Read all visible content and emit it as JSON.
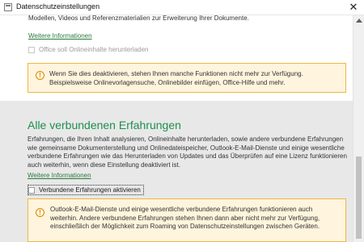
{
  "window": {
    "title": "Datenschutzeinstellungen",
    "close_glyph": "✕"
  },
  "top_section": {
    "intro_fragment": "Modellen, Videos und Referenzmaterialien zur Erweiterung Ihrer Dokumente.",
    "more_info_link": "Weitere Informationen",
    "checkbox_label": "Office soll Onlineinhalte herunterladen",
    "checkbox_checked": false,
    "notice": "Wenn Sie dies deaktivieren, stehen Ihnen manche Funktionen nicht mehr zur Verfügung. Beispielsweise Onlinevorlagensuche, Onlinebilder einfügen, Office-Hilfe und mehr."
  },
  "connected_section": {
    "heading": "Alle verbundenen Erfahrungen",
    "description": "Erfahrungen, die Ihren Inhalt analysieren, Onlineinhalte herunterladen, sowie andere verbundene Erfahrungen wie gemeinsame Dokumenterstellung und Onlinedateispeicher, Outlook-E-Mail-Dienste und einige wesentliche verbundene Erfahrungen wie das Herunterladen von Updates und das Überprüfen auf eine Lizenz funktionieren auch weiterhin, wenn diese Einstellung deaktiviert ist.",
    "more_info_link": "Weitere Informationen",
    "checkbox_label": "Verbundene Erfahrungen aktivieren",
    "checkbox_checked": false,
    "notice": "Outlook-E-Mail-Dienste und einige wesentliche verbundene Erfahrungen funktionieren auch weiterhin. Andere verbundene Erfahrungen stehen Ihnen dann aber nicht mehr zur Verfügung, einschließlich der Möglichkeit zum Roaming von Datenschutzeinstellungen zwischen Geräten."
  },
  "colors": {
    "accent_green": "#1e8f4e",
    "link_green": "#2b7a3d",
    "notice_bg": "#fff4dd",
    "notice_border": "#f0b640",
    "section_gray": "#e8e8e8"
  },
  "icons": {
    "app": "document-icon",
    "warning": "warning-icon",
    "close": "close-icon"
  }
}
